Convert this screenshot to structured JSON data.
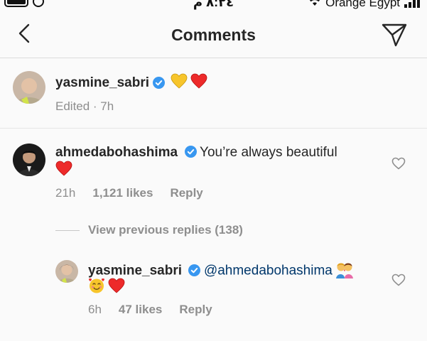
{
  "status_bar": {
    "time": "٨:٢٤ م",
    "carrier": "Orange Egypt"
  },
  "header": {
    "title": "Comments"
  },
  "caption": {
    "username": "yasmine_sabri",
    "emojis": "💛❤️",
    "meta": "Edited · 7h"
  },
  "comments": [
    {
      "username": "ahmedabohashima",
      "text": "You’re always beautiful",
      "emoji_line": "❤️",
      "time": "21h",
      "likes": "1,121 likes",
      "reply_label": "Reply"
    }
  ],
  "view_replies": "View previous replies (138)",
  "reply": {
    "username": "yasmine_sabri",
    "mention": "@ahmedabohashima",
    "emoji_inline": "💏",
    "emoji_line": "🥰❤️",
    "time": "6h",
    "likes": "47 likes",
    "reply_label": "Reply"
  },
  "colors": {
    "verified": "#3897f0",
    "mention": "#00376b",
    "meta_gray": "#8e8e8e",
    "heart_red": "#ed2a2a",
    "heart_yellow": "#f7c52b"
  }
}
